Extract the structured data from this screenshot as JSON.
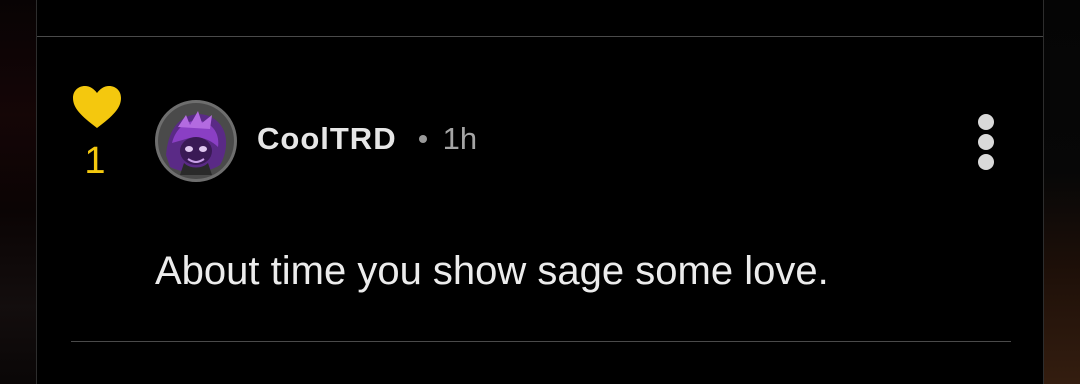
{
  "comment": {
    "like_count": "1",
    "author": "CoolTRD",
    "separator": "•",
    "timestamp": "1h",
    "text": "About time you show sage some love."
  },
  "icons": {
    "like": "heart-icon",
    "avatar": "avatar",
    "more": "more-vertical-icon"
  },
  "colors": {
    "background": "#000000",
    "heart": "#f4c80e",
    "like_count": "#f4c80e",
    "author": "#e6e6e6",
    "timestamp": "#a5a5a5",
    "comment_text": "#ececec",
    "divider": "#4a4a4a",
    "avatar_accent": "#8a3fc4"
  }
}
